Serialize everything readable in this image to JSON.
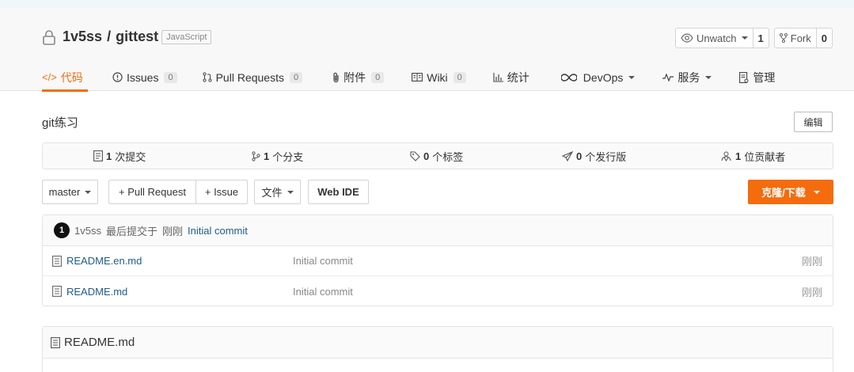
{
  "repo": {
    "owner": "1v5ss",
    "separator": "/",
    "name": "gittest",
    "language": "JavaScript"
  },
  "actions": {
    "watch_label": "Unwatch",
    "watch_count": "1",
    "fork_label": "Fork",
    "fork_count": "0"
  },
  "tabs": [
    {
      "label": "代码",
      "icon": "code-icon",
      "active": true
    },
    {
      "label": "Issues",
      "count": "0",
      "icon": "issue-icon"
    },
    {
      "label": "Pull Requests",
      "count": "0",
      "icon": "pull-request-icon"
    },
    {
      "label": "附件",
      "count": "0",
      "icon": "paperclip-icon"
    },
    {
      "label": "Wiki",
      "count": "0",
      "icon": "book-icon"
    },
    {
      "label": "统计",
      "icon": "bar-chart-icon"
    },
    {
      "label": "DevOps",
      "icon": "infinity-icon",
      "dropdown": true
    },
    {
      "label": "服务",
      "icon": "pulse-icon",
      "dropdown": true
    },
    {
      "label": "管理",
      "icon": "settings-doc-icon"
    }
  ],
  "description": "git练习",
  "edit_label": "编辑",
  "stats": [
    {
      "count": "1",
      "label": "次提交",
      "icon": "commit-icon"
    },
    {
      "count": "1",
      "label": "个分支",
      "icon": "branch-icon"
    },
    {
      "count": "0",
      "label": "个标签",
      "icon": "tag-icon"
    },
    {
      "count": "0",
      "label": "个发行版",
      "icon": "release-icon"
    },
    {
      "count": "1",
      "label": "位贡献者",
      "icon": "contributors-icon"
    }
  ],
  "toolbar": {
    "branch": "master",
    "pull_request": "+ Pull Request",
    "issue": "+ Issue",
    "file_menu": "文件",
    "web_ide": "Web IDE",
    "clone": "克隆/下载"
  },
  "latest_commit": {
    "avatar_text": "1",
    "author": "1v5ss",
    "text": "最后提交于",
    "time": "刚刚",
    "message": "Initial commit"
  },
  "files": [
    {
      "name": "README.en.md",
      "message": "Initial commit",
      "time": "刚刚"
    },
    {
      "name": "README.md",
      "message": "Initial commit",
      "time": "刚刚"
    }
  ],
  "readme": {
    "title": "README.md"
  },
  "colors": {
    "accent": "#f56c0e",
    "link": "#1f5d8b"
  }
}
